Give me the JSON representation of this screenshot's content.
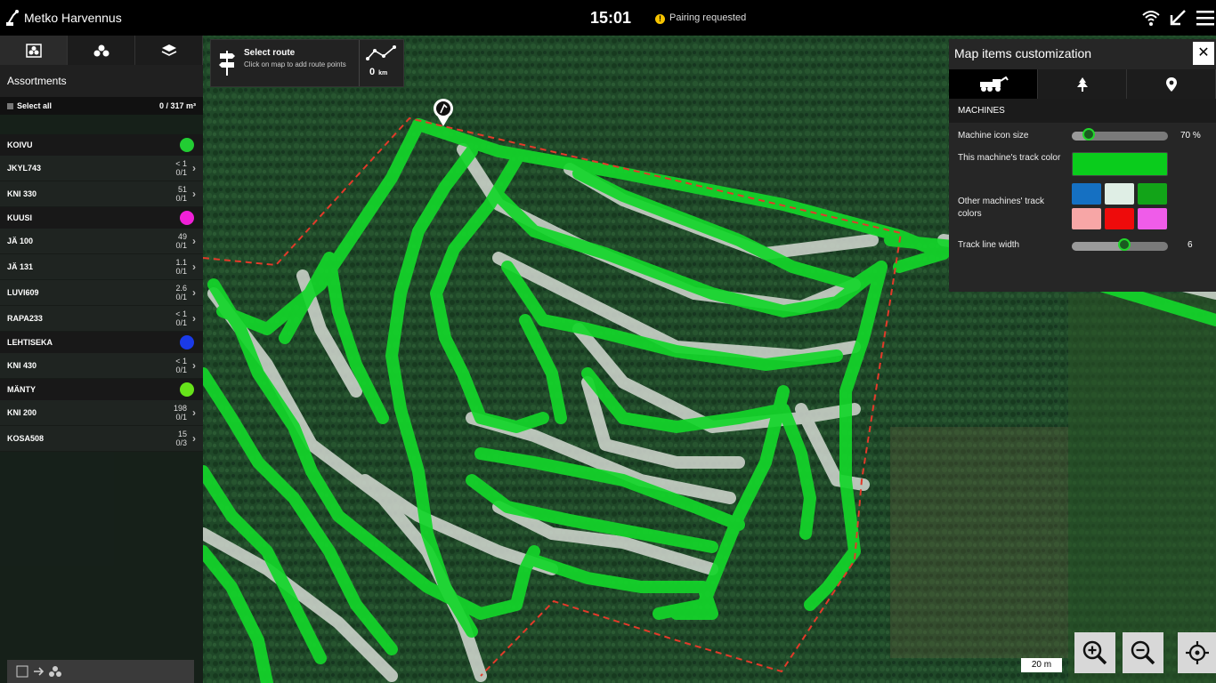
{
  "topbar": {
    "app_title": "Metko Harvennus",
    "clock": "15:01",
    "status": "Pairing requested",
    "status_icon": "!"
  },
  "left_panel": {
    "heading": "Assortments",
    "select_all": "Select all",
    "total": "0 / 317 m³",
    "groups": [
      {
        "name": "KOIVU",
        "color": "#22cc33",
        "items": [
          {
            "name": "JKYL743",
            "top": "< 1",
            "bottom": "0/1"
          },
          {
            "name": "KNI 330",
            "top": "51",
            "bottom": "0/1"
          }
        ]
      },
      {
        "name": "KUUSI",
        "color": "#f020d8",
        "items": [
          {
            "name": "JÄ 100",
            "top": "49",
            "bottom": "0/1"
          },
          {
            "name": "JÄ 131",
            "top": "1.1",
            "bottom": "0/1"
          },
          {
            "name": "LUVI609",
            "top": "2.6",
            "bottom": "0/1"
          },
          {
            "name": "RAPA233",
            "top": "< 1",
            "bottom": "0/1"
          }
        ]
      },
      {
        "name": "LEHTISEKA",
        "color": "#1a3ae8",
        "items": [
          {
            "name": "KNI 430",
            "top": "< 1",
            "bottom": "0/1"
          }
        ]
      },
      {
        "name": "MÄNTY",
        "color": "#66e21a",
        "items": [
          {
            "name": "KNI 200",
            "top": "198",
            "bottom": "0/1"
          },
          {
            "name": "KOSA508",
            "top": "15",
            "bottom": "0/3"
          }
        ]
      }
    ]
  },
  "route": {
    "title": "Select route",
    "subtitle": "Click on map to add route points",
    "distance": "0",
    "unit": "km"
  },
  "customization": {
    "title": "Map items customization",
    "section": "MACHINES",
    "icon_size_label": "Machine icon size",
    "icon_size_value": "70 %",
    "icon_size_fraction": 0.18,
    "track_color_label": "This machine's track color",
    "track_color": "#0acc1c",
    "other_colors_label": "Other machines' track colors",
    "other_colors": [
      "#1570c2",
      "#dfeee5",
      "#12a418",
      "#f7a6a6",
      "#ee0b0b",
      "#ef5ce9"
    ],
    "line_width_label": "Track line width",
    "line_width_value": "6",
    "line_width_fraction": 0.55
  },
  "map": {
    "scale": "20 m"
  }
}
